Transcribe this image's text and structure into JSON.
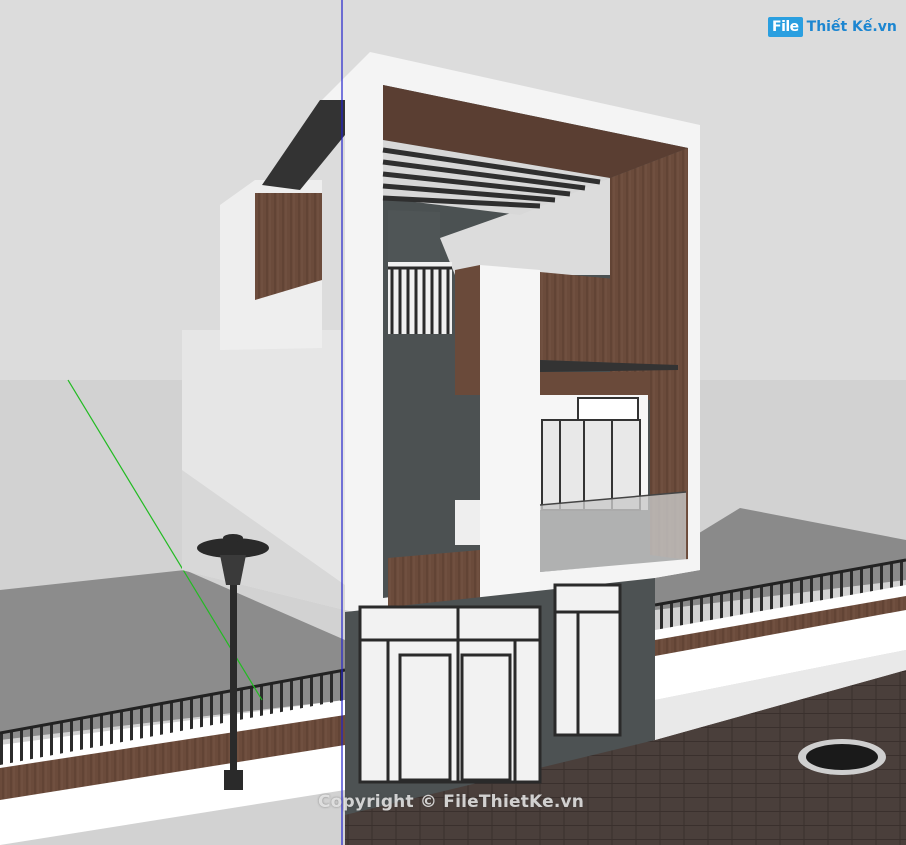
{
  "watermark": {
    "text": "Copyright © FileThietKe.vn"
  },
  "logo": {
    "file_part": "File",
    "rest_part": "Thiết Kế.vn"
  },
  "colors": {
    "sky": "#dcdcdc",
    "ground": "#8a8a8a",
    "wood": "#6a4a3a",
    "dark_stone": "#4c5152",
    "wall": "#f2f2f2",
    "green_axis": "#22bb22",
    "blue_axis": "#2222cc"
  }
}
